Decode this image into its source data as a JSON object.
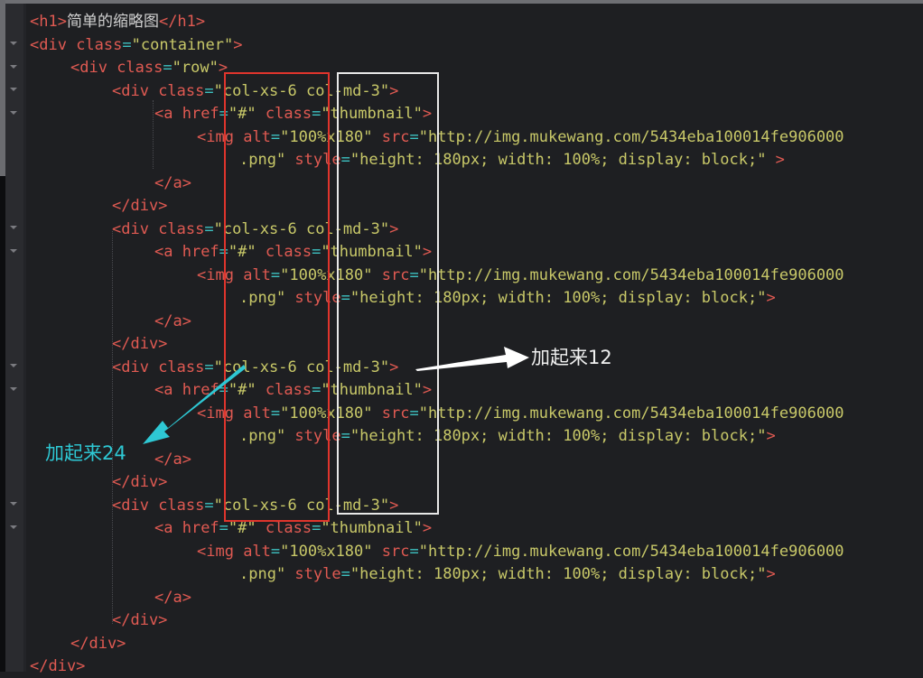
{
  "editor": {
    "lines": [
      {
        "indent": 0,
        "parts": [
          {
            "c": "t",
            "v": "<h1>"
          },
          {
            "c": "x",
            "v": "简单的缩略图"
          },
          {
            "c": "t",
            "v": "</h1>"
          }
        ]
      },
      {
        "indent": 0,
        "parts": [
          {
            "c": "t",
            "v": "<div "
          },
          {
            "c": "a",
            "v": "class"
          },
          {
            "c": "e",
            "v": "="
          },
          {
            "c": "s",
            "v": "\"container\""
          },
          {
            "c": "t",
            "v": ">"
          }
        ]
      },
      {
        "indent": 1,
        "parts": [
          {
            "c": "t",
            "v": "<div "
          },
          {
            "c": "a",
            "v": "class"
          },
          {
            "c": "e",
            "v": "="
          },
          {
            "c": "s",
            "v": "\"row\""
          },
          {
            "c": "t",
            "v": ">"
          }
        ]
      },
      {
        "indent": 2,
        "parts": [
          {
            "c": "t",
            "v": "<div "
          },
          {
            "c": "a",
            "v": "class"
          },
          {
            "c": "e",
            "v": "="
          },
          {
            "c": "s",
            "v": "\"col-xs-6 col-md-3\""
          },
          {
            "c": "t",
            "v": ">"
          }
        ]
      },
      {
        "indent": 3,
        "parts": [
          {
            "c": "t",
            "v": "<a "
          },
          {
            "c": "a",
            "v": "href"
          },
          {
            "c": "e",
            "v": "="
          },
          {
            "c": "s",
            "v": "\"#\" "
          },
          {
            "c": "a",
            "v": "class"
          },
          {
            "c": "e",
            "v": "="
          },
          {
            "c": "s",
            "v": "\"thumbnail\""
          },
          {
            "c": "t",
            "v": ">"
          }
        ]
      },
      {
        "indent": 4,
        "parts": [
          {
            "c": "t",
            "v": "<img "
          },
          {
            "c": "a",
            "v": "alt"
          },
          {
            "c": "e",
            "v": "="
          },
          {
            "c": "s",
            "v": "\"100%x180\" "
          },
          {
            "c": "a",
            "v": "src"
          },
          {
            "c": "e",
            "v": "="
          },
          {
            "c": "s",
            "v": "\"http://img.mukewang.com/5434eba100014fe906000"
          }
        ]
      },
      {
        "indent": 5,
        "parts": [
          {
            "c": "s",
            "v": ".png\" "
          },
          {
            "c": "a",
            "v": "style"
          },
          {
            "c": "e",
            "v": "="
          },
          {
            "c": "s",
            "v": "\"height: 180px; width: 100%; display: block;\" "
          },
          {
            "c": "t",
            "v": ">"
          }
        ]
      },
      {
        "indent": 3,
        "parts": [
          {
            "c": "t",
            "v": "</a>"
          }
        ]
      },
      {
        "indent": 2,
        "parts": [
          {
            "c": "t",
            "v": "</div>"
          }
        ]
      },
      {
        "indent": 2,
        "parts": [
          {
            "c": "t",
            "v": "<div "
          },
          {
            "c": "a",
            "v": "class"
          },
          {
            "c": "e",
            "v": "="
          },
          {
            "c": "s",
            "v": "\"col-xs-6 col-md-3\""
          },
          {
            "c": "t",
            "v": ">"
          }
        ]
      },
      {
        "indent": 3,
        "parts": [
          {
            "c": "t",
            "v": "<a "
          },
          {
            "c": "a",
            "v": "href"
          },
          {
            "c": "e",
            "v": "="
          },
          {
            "c": "s",
            "v": "\"#\" "
          },
          {
            "c": "a",
            "v": "class"
          },
          {
            "c": "e",
            "v": "="
          },
          {
            "c": "s",
            "v": "\"thumbnail\""
          },
          {
            "c": "t",
            "v": ">"
          }
        ]
      },
      {
        "indent": 4,
        "parts": [
          {
            "c": "t",
            "v": "<img "
          },
          {
            "c": "a",
            "v": "alt"
          },
          {
            "c": "e",
            "v": "="
          },
          {
            "c": "s",
            "v": "\"100%x180\" "
          },
          {
            "c": "a",
            "v": "src"
          },
          {
            "c": "e",
            "v": "="
          },
          {
            "c": "s",
            "v": "\"http://img.mukewang.com/5434eba100014fe906000"
          }
        ]
      },
      {
        "indent": 5,
        "parts": [
          {
            "c": "s",
            "v": ".png\" "
          },
          {
            "c": "a",
            "v": "style"
          },
          {
            "c": "e",
            "v": "="
          },
          {
            "c": "s",
            "v": "\"height: 180px; width: 100%; display: block;\""
          },
          {
            "c": "t",
            "v": ">"
          }
        ]
      },
      {
        "indent": 3,
        "parts": [
          {
            "c": "t",
            "v": "</a>"
          }
        ]
      },
      {
        "indent": 2,
        "parts": [
          {
            "c": "t",
            "v": "</div>"
          }
        ]
      },
      {
        "indent": 2,
        "parts": [
          {
            "c": "t",
            "v": "<div "
          },
          {
            "c": "a",
            "v": "class"
          },
          {
            "c": "e",
            "v": "="
          },
          {
            "c": "s",
            "v": "\"col-xs-6 col-md-3\""
          },
          {
            "c": "t",
            "v": ">"
          }
        ]
      },
      {
        "indent": 3,
        "parts": [
          {
            "c": "t",
            "v": "<a "
          },
          {
            "c": "a",
            "v": "href"
          },
          {
            "c": "e",
            "v": "="
          },
          {
            "c": "s",
            "v": "\"#\" "
          },
          {
            "c": "a",
            "v": "class"
          },
          {
            "c": "e",
            "v": "="
          },
          {
            "c": "s",
            "v": "\"thumbnail\""
          },
          {
            "c": "t",
            "v": ">"
          }
        ]
      },
      {
        "indent": 4,
        "parts": [
          {
            "c": "t",
            "v": "<img "
          },
          {
            "c": "a",
            "v": "alt"
          },
          {
            "c": "e",
            "v": "="
          },
          {
            "c": "s",
            "v": "\"100%x180\" "
          },
          {
            "c": "a",
            "v": "src"
          },
          {
            "c": "e",
            "v": "="
          },
          {
            "c": "s",
            "v": "\"http://img.mukewang.com/5434eba100014fe906000"
          }
        ]
      },
      {
        "indent": 5,
        "parts": [
          {
            "c": "s",
            "v": ".png\" "
          },
          {
            "c": "a",
            "v": "style"
          },
          {
            "c": "e",
            "v": "="
          },
          {
            "c": "s",
            "v": "\"height: 180px; width: 100%; display: block;\""
          },
          {
            "c": "t",
            "v": ">"
          }
        ]
      },
      {
        "indent": 3,
        "parts": [
          {
            "c": "t",
            "v": "</a>"
          }
        ]
      },
      {
        "indent": 2,
        "parts": [
          {
            "c": "t",
            "v": "</div>"
          }
        ]
      },
      {
        "indent": 2,
        "parts": [
          {
            "c": "t",
            "v": "<div "
          },
          {
            "c": "a",
            "v": "class"
          },
          {
            "c": "e",
            "v": "="
          },
          {
            "c": "s",
            "v": "\"col-xs-6 col-md-3\""
          },
          {
            "c": "t",
            "v": ">"
          }
        ]
      },
      {
        "indent": 3,
        "parts": [
          {
            "c": "t",
            "v": "<a "
          },
          {
            "c": "a",
            "v": "href"
          },
          {
            "c": "e",
            "v": "="
          },
          {
            "c": "s",
            "v": "\"#\" "
          },
          {
            "c": "a",
            "v": "class"
          },
          {
            "c": "e",
            "v": "="
          },
          {
            "c": "s",
            "v": "\"thumbnail\""
          },
          {
            "c": "t",
            "v": ">"
          }
        ]
      },
      {
        "indent": 4,
        "parts": [
          {
            "c": "t",
            "v": "<img "
          },
          {
            "c": "a",
            "v": "alt"
          },
          {
            "c": "e",
            "v": "="
          },
          {
            "c": "s",
            "v": "\"100%x180\" "
          },
          {
            "c": "a",
            "v": "src"
          },
          {
            "c": "e",
            "v": "="
          },
          {
            "c": "s",
            "v": "\"http://img.mukewang.com/5434eba100014fe906000"
          }
        ]
      },
      {
        "indent": 5,
        "parts": [
          {
            "c": "s",
            "v": ".png\" "
          },
          {
            "c": "a",
            "v": "style"
          },
          {
            "c": "e",
            "v": "="
          },
          {
            "c": "s",
            "v": "\"height: 180px; width: 100%; display: block;\""
          },
          {
            "c": "t",
            "v": ">"
          }
        ]
      },
      {
        "indent": 3,
        "parts": [
          {
            "c": "t",
            "v": "</a>"
          }
        ]
      },
      {
        "indent": 2,
        "parts": [
          {
            "c": "t",
            "v": "</div>"
          }
        ]
      },
      {
        "indent": 1,
        "parts": [
          {
            "c": "t",
            "v": "</div>"
          }
        ]
      },
      {
        "indent": 0,
        "parts": [
          {
            "c": "t",
            "v": "</div>"
          }
        ]
      }
    ]
  },
  "annotations": {
    "label_12": "加起来12",
    "label_24": "加起来24",
    "colors": {
      "red_box": "#e0342c",
      "white_box": "#e8e8e8",
      "cyan_arrow": "#2ec8d4",
      "white_arrow": "#ffffff"
    }
  }
}
